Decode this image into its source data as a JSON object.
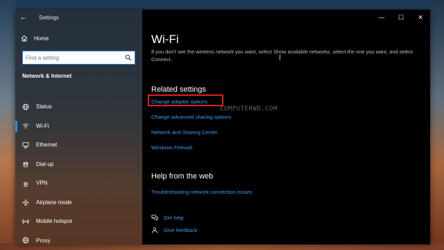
{
  "window": {
    "title": "Settings"
  },
  "controls": {
    "back": "←",
    "minimize": "—",
    "maximize": "☐",
    "close": "✕"
  },
  "sidebar": {
    "home_label": "Home",
    "search_placeholder": "Find a setting",
    "section_title": "Network & Internet",
    "items": [
      {
        "label": "Status",
        "icon": "globe-icon",
        "active": false
      },
      {
        "label": "Wi-Fi",
        "icon": "wifi-icon",
        "active": true
      },
      {
        "label": "Ethernet",
        "icon": "ethernet-icon",
        "active": false
      },
      {
        "label": "Dial-up",
        "icon": "dialup-icon",
        "active": false
      },
      {
        "label": "VPN",
        "icon": "vpn-icon",
        "active": false
      },
      {
        "label": "Airplane mode",
        "icon": "airplane-icon",
        "active": false
      },
      {
        "label": "Mobile hotspot",
        "icon": "hotspot-icon",
        "active": false
      },
      {
        "label": "Proxy",
        "icon": "globe-icon",
        "active": false
      }
    ]
  },
  "main": {
    "title": "Wi-Fi",
    "description": "If you don't see the wireless network you want, select Show available networks, select the one you want, and select Connect.",
    "cursor": "I",
    "related_title": "Related settings",
    "related_links": [
      "Change adapter options",
      "Change advanced sharing options",
      "Network and Sharing Center",
      "Windows Firewall"
    ],
    "help_title": "Help from the web",
    "help_links": [
      "Troubleshooting network connection issues"
    ],
    "get_help": "Get help",
    "give_feedback": "Give feedback",
    "watermark": "COMPUTERWD.COM"
  },
  "colors": {
    "accent": "#3f9bf0",
    "highlight": "#e02020",
    "active_bar": "#2b8be6"
  }
}
